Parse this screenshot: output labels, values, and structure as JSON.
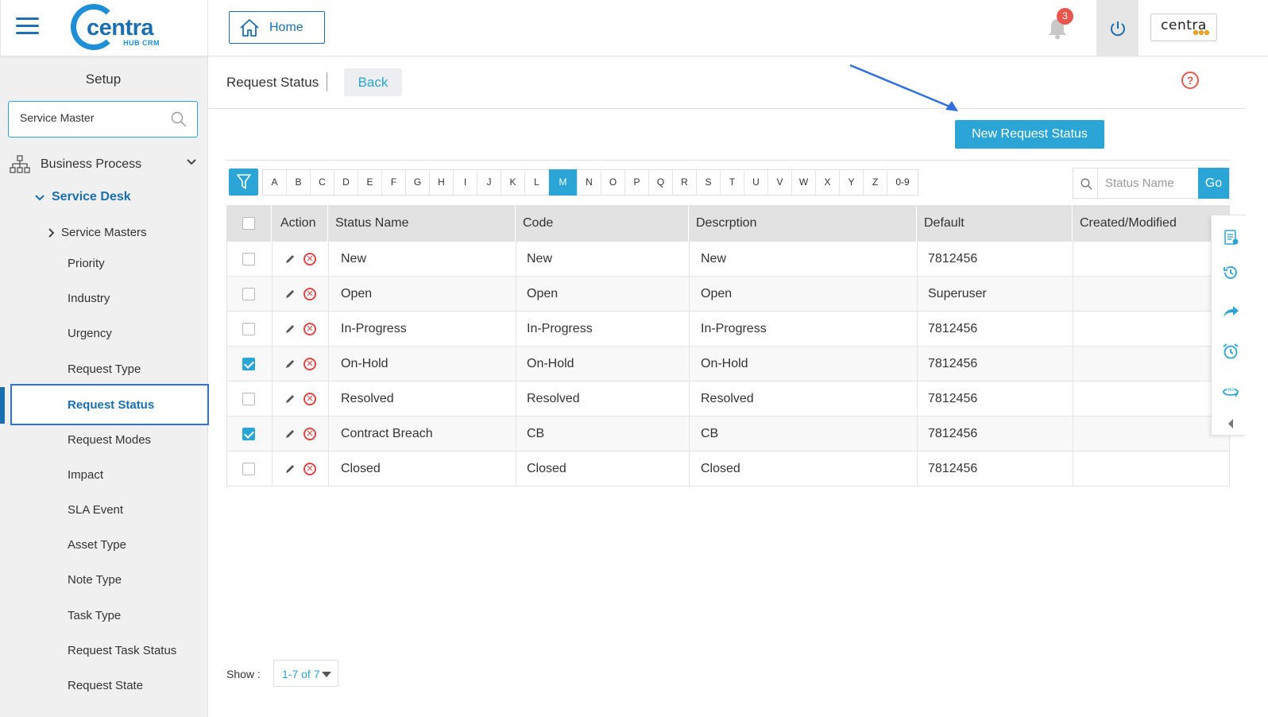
{
  "header": {
    "logo_text": "centra",
    "logo_sub": "HUB CRM",
    "home_label": "Home",
    "notification_count": "3",
    "brand_label": "centra"
  },
  "sidebar": {
    "title": "Setup",
    "search_value": "Service Master",
    "business_process": "Business Process",
    "service_desk": "Service Desk",
    "service_masters": "Service Masters",
    "items": [
      "Priority",
      "Industry",
      "Urgency",
      "Request Type",
      "Request Status",
      "Request Modes",
      "Impact",
      "SLA Event",
      "Asset Type",
      "Note Type",
      "Task Type",
      "Request Task Status",
      "Request State"
    ],
    "active_item": "Request Status"
  },
  "main": {
    "title": "Request Status",
    "back_label": "Back",
    "help_glyph": "?",
    "new_button": "New Request  Status",
    "alphabet": [
      "A",
      "B",
      "C",
      "D",
      "E",
      "F",
      "G",
      "H",
      "I",
      "J",
      "K",
      "L",
      "M",
      "N",
      "O",
      "P",
      "Q",
      "R",
      "S",
      "T",
      "U",
      "V",
      "W",
      "X",
      "Y",
      "Z",
      "0-9"
    ],
    "alphabet_selected": "M",
    "search_placeholder": "Status Name",
    "go_label": "Go",
    "columns": [
      "Action",
      "Status Name",
      "Code",
      "Descrption",
      "Default",
      "Created/Modified"
    ],
    "rows": [
      {
        "checked": false,
        "name": "New",
        "code": "New",
        "description": "New",
        "default": "7812456",
        "created": ""
      },
      {
        "checked": false,
        "name": "Open",
        "code": "Open",
        "description": "Open",
        "default": "Superuser",
        "created": ""
      },
      {
        "checked": false,
        "name": "In-Progress",
        "code": "In-Progress",
        "description": "In-Progress",
        "default": "7812456",
        "created": ""
      },
      {
        "checked": true,
        "name": "On-Hold",
        "code": "On-Hold",
        "description": "On-Hold",
        "default": "7812456",
        "created": ""
      },
      {
        "checked": false,
        "name": "Resolved",
        "code": "Resolved",
        "description": "Resolved",
        "default": "7812456",
        "created": ""
      },
      {
        "checked": true,
        "name": "Contract Breach",
        "code": "CB",
        "description": "CB",
        "default": "7812456",
        "created": ""
      },
      {
        "checked": false,
        "name": "Closed",
        "code": "Closed",
        "description": "Closed",
        "default": "7812456",
        "created": ""
      }
    ],
    "show_label": "Show :",
    "show_value": "1-7 of 7"
  },
  "colors": {
    "accent": "#2aa5d6",
    "brand": "#1a6fb0",
    "danger": "#e04545",
    "highlight_box": "#2f6fe0"
  },
  "icons": [
    "hamburger-icon",
    "home-icon",
    "bell-icon",
    "power-icon",
    "search-icon",
    "filter-icon",
    "edit-icon",
    "delete-icon",
    "clipboard-icon",
    "history-icon",
    "share-icon",
    "alarm-icon",
    "view-360-icon",
    "collapse-left-icon",
    "help-icon"
  ]
}
